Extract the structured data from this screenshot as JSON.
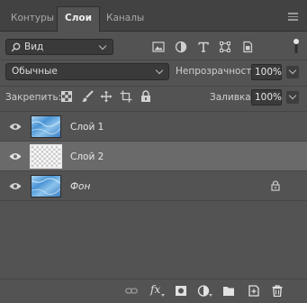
{
  "tabs": [
    {
      "label": "Контуры"
    },
    {
      "label": "Слои"
    },
    {
      "label": "Каналы"
    }
  ],
  "filter": {
    "kind_label": "Вид"
  },
  "blend": {
    "mode": "Обычные",
    "opacity_label": "Непрозрачность:",
    "opacity_value": "100%"
  },
  "lock": {
    "label": "Закрепить:",
    "fill_label": "Заливка:",
    "fill_value": "100%"
  },
  "layers": [
    {
      "name": "Слой 1",
      "selected": false,
      "locked": false
    },
    {
      "name": "Слой 2",
      "selected": true,
      "locked": false
    },
    {
      "name": "Фон",
      "selected": false,
      "locked": true
    }
  ],
  "bottom": {
    "fx_label": "fx"
  },
  "colors": {
    "panel": "#535353",
    "tabbar": "#424242",
    "selected_row": "#6a6a6a",
    "field": "#3a3a3a"
  }
}
